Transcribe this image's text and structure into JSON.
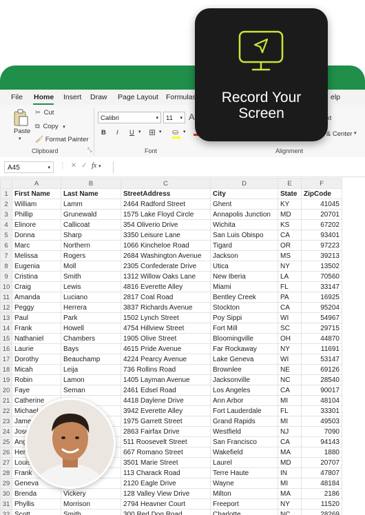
{
  "menu": {
    "tabs": [
      "File",
      "Home",
      "Insert",
      "Draw",
      "Page Layout",
      "Formulas",
      "elp"
    ]
  },
  "ribbon": {
    "paste": "Paste",
    "cut": "Cut",
    "copy": "Copy",
    "format_painter": "Format Painter",
    "clipboard_label": "Clipboard",
    "font_name": "Calibri",
    "font_size": "11",
    "font_label": "Font",
    "alignment_label": "Alignment",
    "wrap_text_partial": "xt",
    "merge_center_partial": "e & Center",
    "bold": "B",
    "italic": "I",
    "underline": "U"
  },
  "formula_bar": {
    "cell_ref": "A45",
    "fx": "fx"
  },
  "overlay": {
    "title_line1": "Record Your",
    "title_line2": "Screen"
  },
  "sheet": {
    "columns": [
      "A",
      "B",
      "C",
      "D",
      "E",
      "F"
    ],
    "headers": [
      "First Name",
      "Last Name",
      "StreetAddress",
      "City",
      "State",
      "ZipCode"
    ],
    "rows": [
      [
        "William",
        "Lamm",
        "2464 Radford Street",
        "Ghent",
        "KY",
        "41045"
      ],
      [
        "Phillip",
        "Grunewald",
        "1575 Lake Floyd Circle",
        "Annapolis Junction",
        "MD",
        "20701"
      ],
      [
        "Elinore",
        "Callicoat",
        "354 Oliverio Drive",
        "Wichita",
        "KS",
        "67202"
      ],
      [
        "Donna",
        "Sharp",
        "3350 Leisure Lane",
        "San Luis Obispo",
        "CA",
        "93401"
      ],
      [
        "Marc",
        "Northern",
        "1066 Kincheloe Road",
        "Tigard",
        "OR",
        "97223"
      ],
      [
        "Melissa",
        "Rogers",
        "2684 Washington Avenue",
        "Jackson",
        "MS",
        "39213"
      ],
      [
        "Eugenia",
        "Moll",
        "2305 Confederate Drive",
        "Utica",
        "NY",
        "13502"
      ],
      [
        "Cristina",
        "Smith",
        "1312 Willow Oaks Lane",
        "New Iberia",
        "LA",
        "70560"
      ],
      [
        "Craig",
        "Lewis",
        "4816 Everette Alley",
        "Miami",
        "FL",
        "33147"
      ],
      [
        "Amanda",
        "Luciano",
        "2817 Coal Road",
        "Bentley Creek",
        "PA",
        "16925"
      ],
      [
        "Peggy",
        "Herrera",
        "3837 Richards Avenue",
        "Stockton",
        "CA",
        "95204"
      ],
      [
        "Paul",
        "Park",
        "1502 Lynch Street",
        "Poy Sippi",
        "WI",
        "54967"
      ],
      [
        "Frank",
        "Howell",
        "4754 Hillview Street",
        "Fort Mill",
        "SC",
        "29715"
      ],
      [
        "Nathaniel",
        "Chambers",
        "1905 Olive Street",
        "Bloomingville",
        "OH",
        "44870"
      ],
      [
        "Laurie",
        "Bays",
        "4615 Pride Avenue",
        "Far Rockaway",
        "NY",
        "11691"
      ],
      [
        "Dorothy",
        "Beauchamp",
        "4224 Pearcy Avenue",
        "Lake Geneva",
        "WI",
        "53147"
      ],
      [
        "Micah",
        "Leija",
        "736 Rollins Road",
        "Brownlee",
        "NE",
        "69126"
      ],
      [
        "Robin",
        "Lamon",
        "1405 Layman Avenue",
        "Jacksonville",
        "NC",
        "28540"
      ],
      [
        "Faye",
        "Seman",
        "2461 Edsel Road",
        "Los Angeles",
        "CA",
        "90017"
      ],
      [
        "Catherine",
        "",
        "4418 Daylene Drive",
        "Ann Arbor",
        "MI",
        "48104"
      ],
      [
        "Michael",
        "",
        "3942 Everette Alley",
        "Fort Lauderdale",
        "FL",
        "33301"
      ],
      [
        "James",
        "",
        "1975 Garrett Street",
        "Grand Rapids",
        "MI",
        "49503"
      ],
      [
        "Jose",
        "",
        "2863 Fairfax Drive",
        "Westfield",
        "NJ",
        "7090"
      ],
      [
        "Angel",
        "",
        "511 Roosevelt Street",
        "San Francisco",
        "CA",
        "94143"
      ],
      [
        "Henry",
        "",
        "667 Romano Street",
        "Wakefield",
        "MA",
        "1880"
      ],
      [
        "Louis",
        "",
        "3501 Marie Street",
        "Laurel",
        "MD",
        "20707"
      ],
      [
        "Frank",
        "",
        "113 Charack Road",
        "Terre Haute",
        "IN",
        "47807"
      ],
      [
        "Geneva",
        "",
        "2120 Eagle Drive",
        "Wayne",
        "MI",
        "48184"
      ],
      [
        "Brenda",
        "Vickery",
        "128 Valley View Drive",
        "Milton",
        "MA",
        "2186"
      ],
      [
        "Phyllis",
        "Morrison",
        "2794 Heavner Court",
        "Freeport",
        "NY",
        "11520"
      ],
      [
        "Scott",
        "Smith",
        "300 Red Dog Road",
        "Charlotte",
        "NC",
        "28269"
      ]
    ]
  },
  "colors": {
    "excel_green": "#1f8f4a",
    "card_bg": "#1b1b1b",
    "icon_accent": "#c8e639"
  }
}
